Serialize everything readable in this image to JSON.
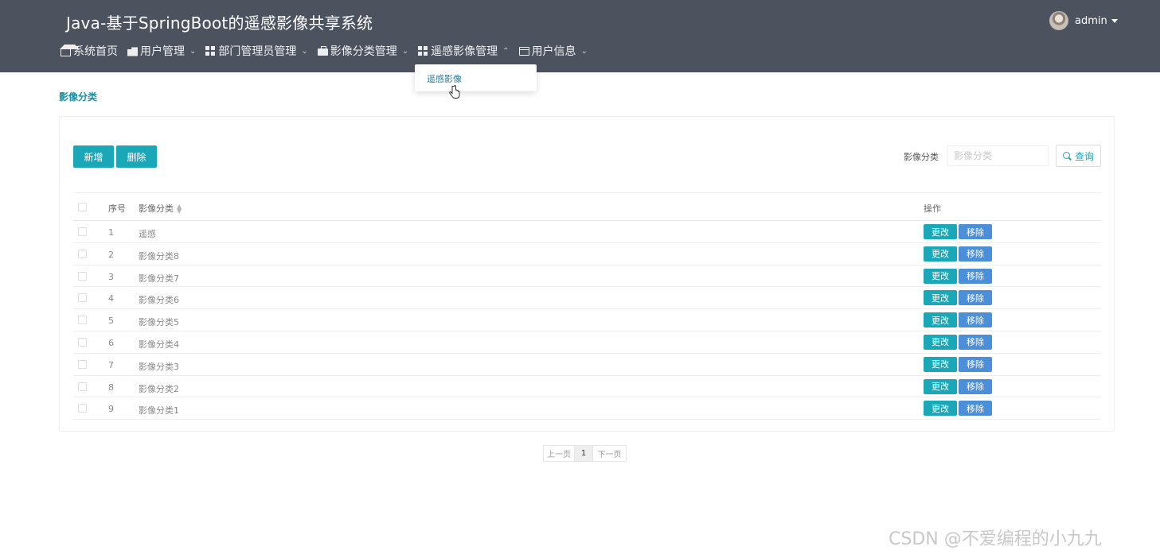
{
  "header": {
    "app_title": "Java-基于SpringBoot的遥感影像共享系统",
    "user_name": "admin"
  },
  "nav": [
    {
      "label": "系统首页",
      "icon": "home-icon"
    },
    {
      "label": "用户管理",
      "icon": "user-icon"
    },
    {
      "label": "部门管理员管理",
      "icon": "grid-icon"
    },
    {
      "label": "影像分类管理",
      "icon": "briefcase-icon"
    },
    {
      "label": "遥感影像管理",
      "icon": "grid-icon"
    },
    {
      "label": "用户信息",
      "icon": "card-icon"
    }
  ],
  "dropdown": {
    "item": "遥感影像"
  },
  "breadcrumb": "影像分类",
  "toolbar": {
    "add_label": "新增",
    "delete_label": "删除"
  },
  "search": {
    "label": "影像分类",
    "placeholder": "影像分类",
    "button_label": "查询"
  },
  "table": {
    "headers": {
      "index": "序号",
      "name": "影像分类",
      "actions": "操作"
    },
    "edit_label": "更改",
    "remove_label": "移除",
    "rows": [
      {
        "index": "1",
        "name": "遥感"
      },
      {
        "index": "2",
        "name": "影像分类8"
      },
      {
        "index": "3",
        "name": "影像分类7"
      },
      {
        "index": "4",
        "name": "影像分类6"
      },
      {
        "index": "5",
        "name": "影像分类5"
      },
      {
        "index": "6",
        "name": "影像分类4"
      },
      {
        "index": "7",
        "name": "影像分类3"
      },
      {
        "index": "8",
        "name": "影像分类2"
      },
      {
        "index": "9",
        "name": "影像分类1"
      }
    ]
  },
  "pagination": {
    "prev": "上一页",
    "current": "1",
    "next": "下一页"
  },
  "watermark": "CSDN @不爱编程的小九九",
  "colors": {
    "header_bg": "#4d525f",
    "primary": "#1aa8b8",
    "remove": "#4a8fd8"
  }
}
